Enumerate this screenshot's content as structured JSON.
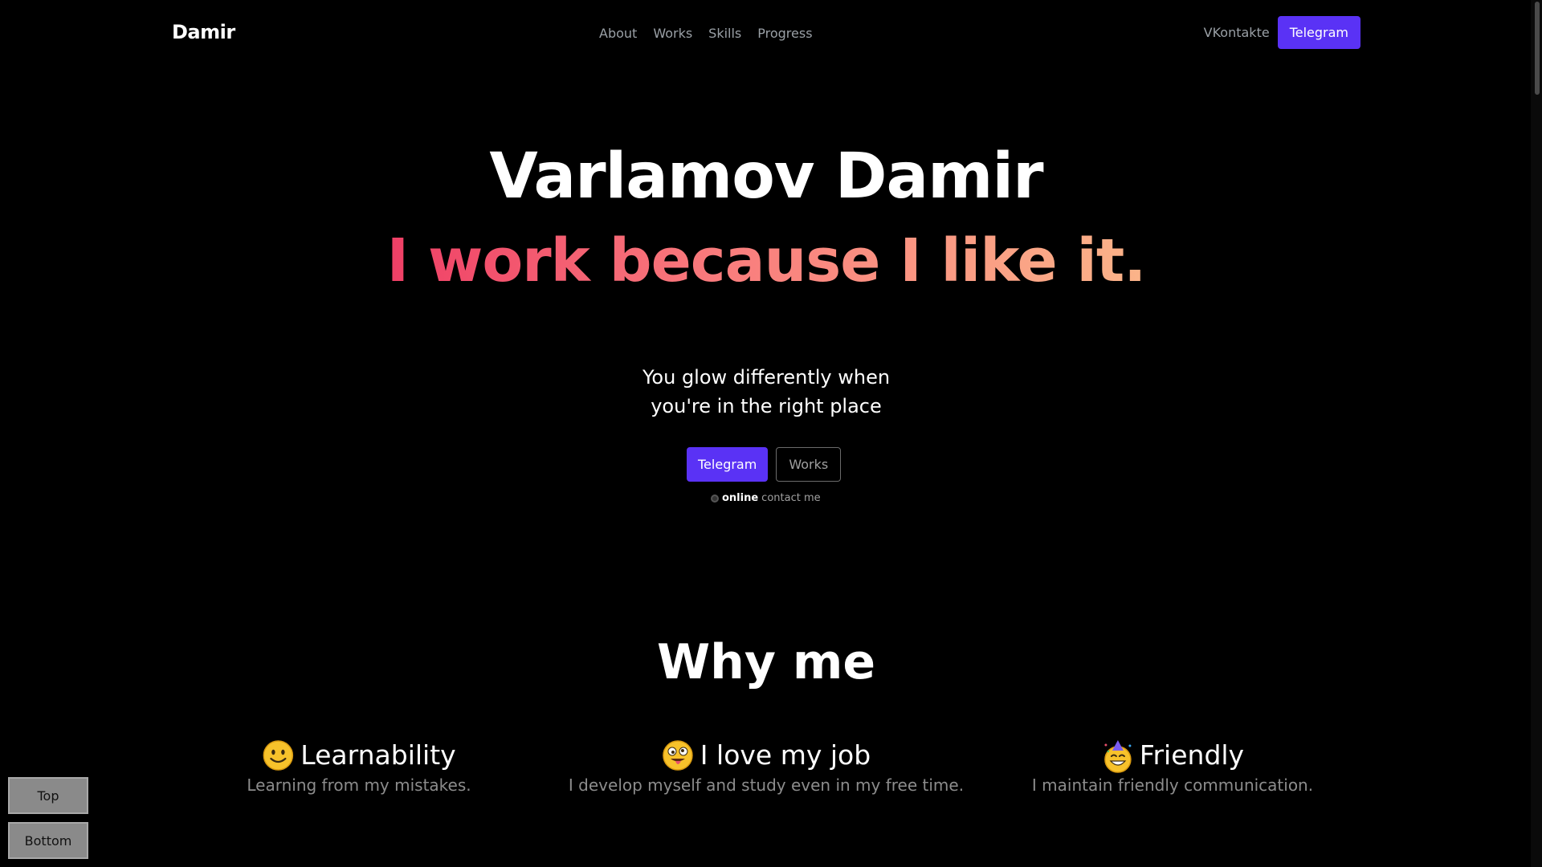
{
  "header": {
    "logo": "Damir",
    "nav": [
      "About",
      "Works",
      "Skills",
      "Progress"
    ],
    "vk_label": "VKontakte",
    "telegram_label": "Telegram"
  },
  "hero": {
    "name": "Varlamov Damir",
    "tagline": "I work because I like it.",
    "subtitle_line1": "You glow differently when",
    "subtitle_line2": "you're in the right place",
    "telegram_button": "Telegram",
    "works_button": "Works",
    "status_online": "online",
    "status_contact": "contact me"
  },
  "why": {
    "title": "Why me",
    "features": [
      {
        "title": "Learnability",
        "desc": "Learning from my mistakes.",
        "icon": "smiling-face-icon"
      },
      {
        "title": "I love my job",
        "desc": "I develop myself and study even in my free time.",
        "icon": "goofy-face-icon"
      },
      {
        "title": "Friendly",
        "desc": "I maintain friendly communication.",
        "icon": "party-face-icon"
      }
    ]
  },
  "side": {
    "top_label": "Top",
    "bottom_label": "Bottom"
  },
  "colors": {
    "accent": "#5a32f5",
    "gradient_start": "#ef3f66",
    "gradient_end": "#fbb489",
    "background": "#000000"
  }
}
